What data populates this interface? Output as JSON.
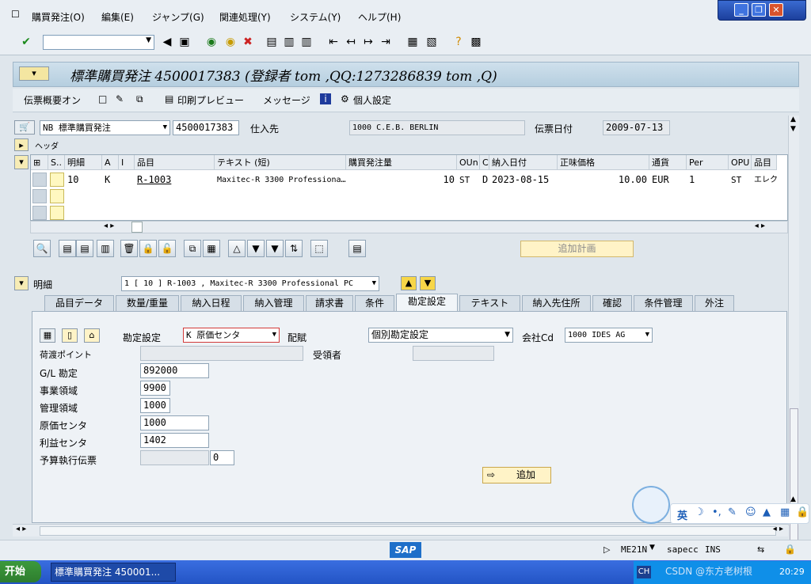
{
  "menu": [
    "購買発注(O)",
    "編集(E)",
    "ジャンプ(G)",
    "関連処理(Y)",
    "システム(Y)",
    "ヘルプ(H)"
  ],
  "title": "標準購買発注 4500017383 (登録者 tom ,QQ:1273286839 tom ,Q)",
  "app_toolbar": {
    "overview": "伝票概要オン",
    "print_preview": "印刷プレビュー",
    "messages": "メッセージ",
    "personal": "個人設定"
  },
  "header": {
    "doctype": "NB 標準購買発注",
    "po_number": "4500017383",
    "vendor_label": "仕入先",
    "vendor_value": "1000 C.E.B. BERLIN",
    "docdate_label": "伝票日付",
    "docdate_value": "2009-07-13",
    "header_label": "ヘッダ"
  },
  "items": {
    "columns": [
      "S..",
      "明細",
      "A",
      "I",
      "品目",
      "テキスト (短)",
      "購買発注量",
      "OUn",
      "C",
      "納入日付",
      "正味価格",
      "通貨",
      "Per",
      "OPU",
      "品目"
    ],
    "rows": [
      {
        "item": "10",
        "a": "K",
        "i": "",
        "material": "R-1003",
        "text": "Maxitec-R 3300 Professiona…",
        "qty": "10",
        "oun": "ST",
        "c": "D",
        "date": "2023-08-15",
        "price": "10.00",
        "curr": "EUR",
        "per": "1",
        "opu": "ST",
        "grp": "エレク"
      }
    ],
    "plan_button": "追加計画"
  },
  "detail": {
    "label": "明細",
    "selector": "1 [ 10 ] R-1003 , Maxitec-R 3300 Professional PC",
    "tabs": [
      "品目データ",
      "数量/重量",
      "納入日程",
      "納入管理",
      "請求書",
      "条件",
      "勘定設定",
      "テキスト",
      "納入先住所",
      "確認",
      "条件管理",
      "外注"
    ],
    "active_tab": "勘定設定",
    "acct_setting_label": "勘定設定",
    "acct_setting_value": "K 原価センタ",
    "distrib_label": "配賦",
    "distrib_value": "個別勘定設定",
    "company_label": "会社Cd",
    "company_value": "1000 IDES AG",
    "unloading_label": "荷渡ポイント",
    "recipient_label": "受領者",
    "fields": [
      {
        "label": "G/L 勘定",
        "value": "892000"
      },
      {
        "label": "事業領域",
        "value": "9900"
      },
      {
        "label": "管理領域",
        "value": "1000"
      },
      {
        "label": "原価センタ",
        "value": "1000"
      },
      {
        "label": "利益センタ",
        "value": "1402"
      },
      {
        "label": "予算執行伝票",
        "value": "",
        "extra": "0"
      }
    ],
    "add_button": "追加"
  },
  "status": {
    "tcode": "ME21N",
    "server": "sapecc",
    "mode": "INS"
  },
  "taskbar": {
    "start": "开始",
    "task": "標準購買発注 450001...",
    "time": "20:29",
    "ch": "CH"
  },
  "ime": {
    "lang": "英"
  },
  "watermark": "CSDN @东方老树根"
}
